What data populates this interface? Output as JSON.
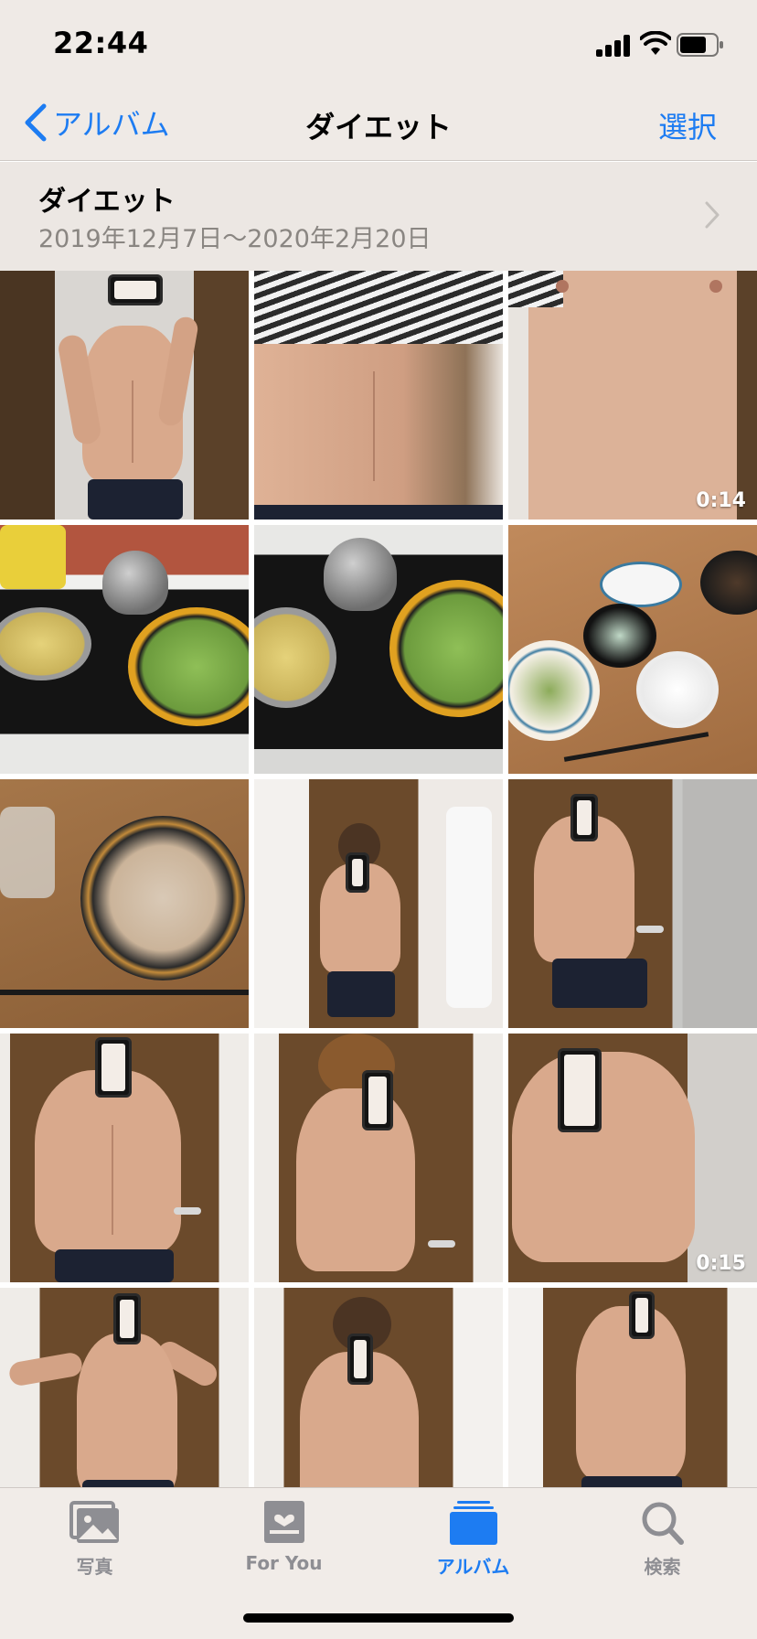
{
  "status_bar": {
    "time": "22:44",
    "icons": [
      "signal-icon",
      "wifi-icon",
      "battery-icon"
    ]
  },
  "nav": {
    "back_label": "アルバム",
    "title": "ダイエット",
    "select_label": "選択"
  },
  "album": {
    "title": "ダイエット",
    "date_range": "2019年12月7日〜2020年2月20日"
  },
  "grid": {
    "items": [
      {
        "kind": "photo",
        "subject": "mirror-selfie"
      },
      {
        "kind": "photo",
        "subject": "torso-closeup"
      },
      {
        "kind": "video",
        "subject": "chest-closeup",
        "duration": "0:14"
      },
      {
        "kind": "photo",
        "subject": "cooking-stove"
      },
      {
        "kind": "photo",
        "subject": "cooking-stove"
      },
      {
        "kind": "photo",
        "subject": "meal-table"
      },
      {
        "kind": "photo",
        "subject": "meal-plate"
      },
      {
        "kind": "photo",
        "subject": "mirror-selfie"
      },
      {
        "kind": "photo",
        "subject": "mirror-selfie"
      },
      {
        "kind": "photo",
        "subject": "mirror-selfie"
      },
      {
        "kind": "photo",
        "subject": "mirror-selfie"
      },
      {
        "kind": "video",
        "subject": "mirror-selfie",
        "duration": "0:15"
      },
      {
        "kind": "photo",
        "subject": "mirror-selfie"
      },
      {
        "kind": "photo",
        "subject": "mirror-selfie"
      },
      {
        "kind": "photo",
        "subject": "mirror-selfie"
      }
    ]
  },
  "tab_bar": {
    "tabs": [
      {
        "label": "写真",
        "icon": "photos-icon",
        "active": false
      },
      {
        "label": "For You",
        "icon": "for-you-icon",
        "active": false
      },
      {
        "label": "アルバム",
        "icon": "albums-icon",
        "active": true
      },
      {
        "label": "検索",
        "icon": "search-icon",
        "active": false
      }
    ]
  },
  "colors": {
    "accent": "#1d7cf2",
    "inactive_tab": "#8e8e93",
    "bar_background": "#efeae6"
  }
}
